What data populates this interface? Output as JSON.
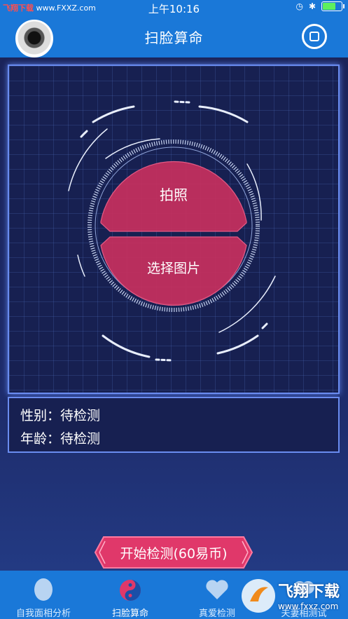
{
  "status_bar": {
    "watermark_text": "飞翔下载",
    "watermark_url": "www.FXXZ.com",
    "time": "上午10:16"
  },
  "nav": {
    "title": "扫脸算命",
    "avatar_icon": "avatar-photo",
    "menu_icon": "square-circle-icon"
  },
  "scan": {
    "take_photo_label": "拍照",
    "choose_image_label": "选择图片",
    "accent_color": "#d0305e"
  },
  "info": {
    "gender_label": "性别：",
    "gender_value": "待检测",
    "age_label": "年龄：",
    "age_value": "待检测"
  },
  "start_button": {
    "label": "开始检测(60易币)"
  },
  "tabbar": {
    "tabs": [
      {
        "label": "自我面相分析",
        "icon": "face-icon"
      },
      {
        "label": "扫脸算命",
        "icon": "yin-yang-icon"
      },
      {
        "label": "真爱检测",
        "icon": "heart-icon"
      },
      {
        "label": "夫妻相测试",
        "icon": "couple-icon"
      }
    ]
  },
  "corner_watermark": {
    "title": "飞翔下载",
    "url": "www.fxxz.com"
  }
}
